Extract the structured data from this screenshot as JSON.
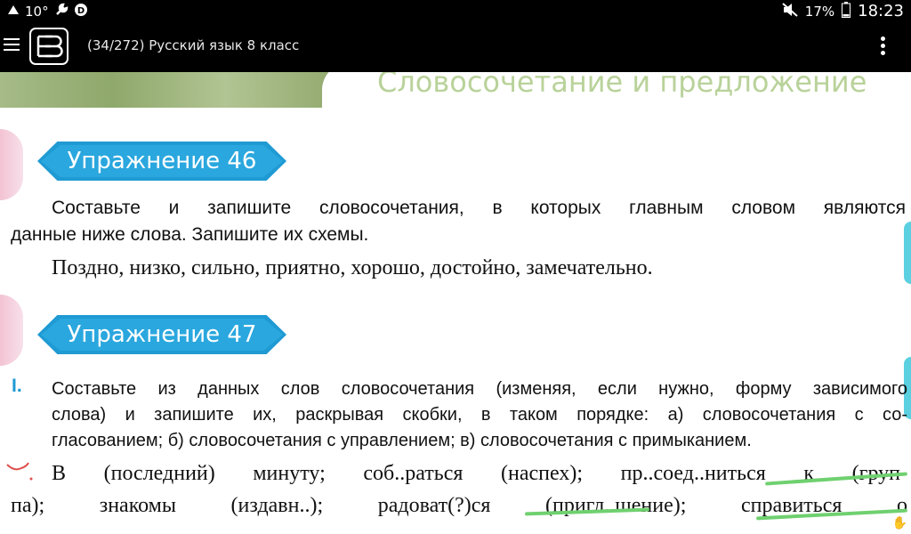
{
  "status_bar": {
    "left_icons": [
      "triangle-icon",
      "wrench-icon",
      "d-badge-icon"
    ],
    "temperature": "10°",
    "battery": "17%",
    "time": "18:23"
  },
  "app_bar": {
    "title": "(34/272) Русский язык 8 класс"
  },
  "page": {
    "heading": "Словосочетание и предложение",
    "exercises": [
      {
        "title": "Упражнение 46",
        "instruction_1": "Составьте и запишите словосочетания, в которых главным словом являются",
        "instruction_2": "данные ниже слова. Запишите их схемы.",
        "words": "Поздно, низко, сильно, приятно, хорошо, достойно, замечательно."
      },
      {
        "title": "Упражнение 47",
        "part_marker": "I.",
        "instruction_1": "Составьте из данных слов словосочетания (изменяя, если нужно, форму зависимого",
        "instruction_2": "слова) и запишите их, раскрывая скобки, в таком порядке: а) словосочетания с со-",
        "instruction_3": "гласованием; б) словосочетания с управлением; в) словосочетания с примыканием.",
        "task_line_1": "В (последний) минуту; соб..раться (наспех); пр..соед..ниться к (груп-",
        "task_line_2": "па); знакомы (издавн..); радоват(?)ся (пригл..шение); справиться о"
      }
    ]
  }
}
